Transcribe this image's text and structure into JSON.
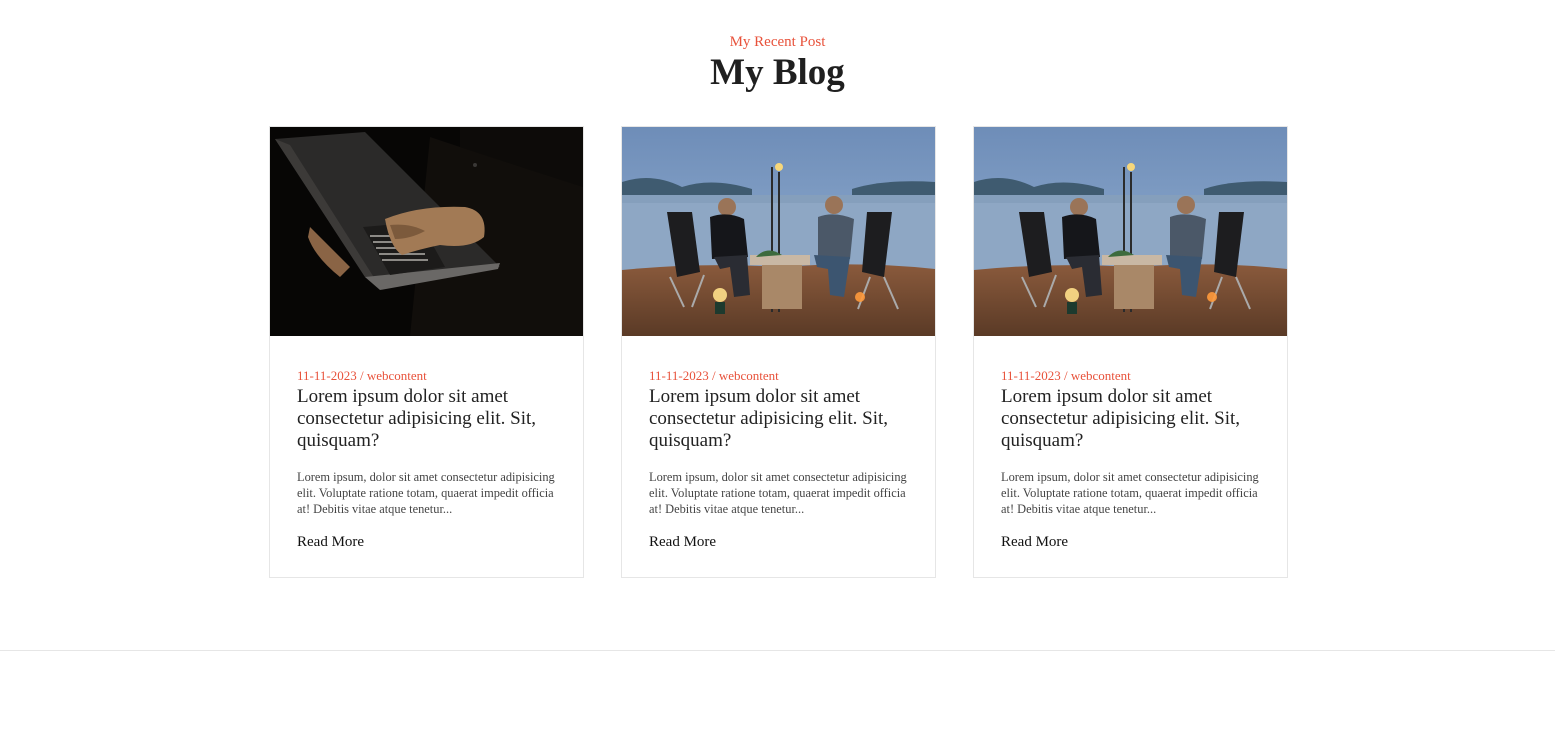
{
  "header": {
    "eyebrow": "My Recent Post",
    "title": "My Blog"
  },
  "posts": [
    {
      "image_icon": "laptop-photo",
      "date": "11-11-2023",
      "category": "webcontent",
      "title": "Lorem ipsum dolor sit amet consectetur adipisicing elit. Sit, quisquam?",
      "excerpt": "Lorem ipsum, dolor sit amet consectetur adipisicing elit. Voluptate ratione totam, quaerat impedit officia at! Debitis vitae atque tenetur...",
      "read_more": "Read More"
    },
    {
      "image_icon": "camping-photo",
      "date": "11-11-2023",
      "category": "webcontent",
      "title": "Lorem ipsum dolor sit amet consectetur adipisicing elit. Sit, quisquam?",
      "excerpt": "Lorem ipsum, dolor sit amet consectetur adipisicing elit. Voluptate ratione totam, quaerat impedit officia at! Debitis vitae atque tenetur...",
      "read_more": "Read More"
    },
    {
      "image_icon": "camping-photo",
      "date": "11-11-2023",
      "category": "webcontent",
      "title": "Lorem ipsum dolor sit amet consectetur adipisicing elit. Sit, quisquam?",
      "excerpt": "Lorem ipsum, dolor sit amet consectetur adipisicing elit. Voluptate ratione totam, quaerat impedit officia at! Debitis vitae atque tenetur...",
      "read_more": "Read More"
    }
  ],
  "colors": {
    "accent": "#e8523b",
    "heading": "#1f1f1f",
    "border": "#e6e6e6"
  }
}
